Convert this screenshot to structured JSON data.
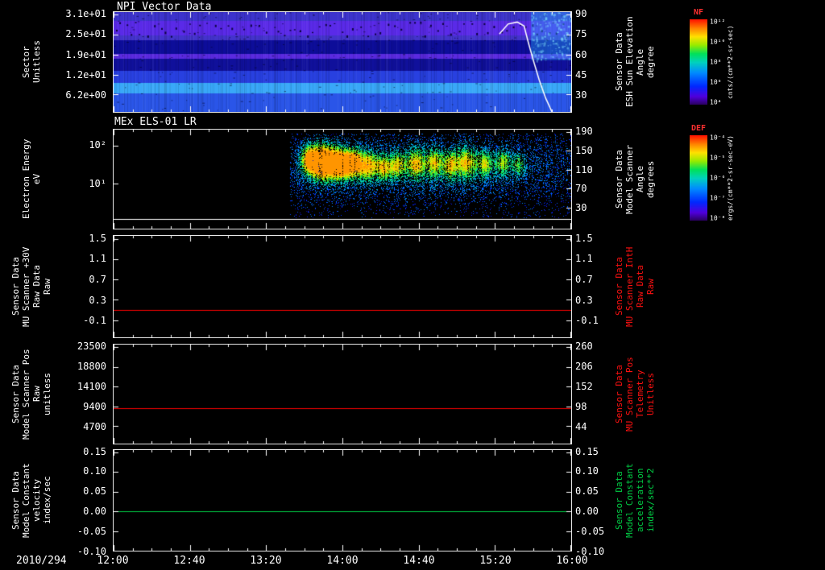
{
  "page": {
    "background": "#000000",
    "foreground": "#ffffff",
    "accent_red": "#ff1111",
    "accent_green": "#00cc44"
  },
  "titles": {
    "panel1": "NPI Vector Data",
    "panel2": "MEx ELS-01 LR"
  },
  "xaxis": {
    "date_label": "2010/294",
    "tick_labels": [
      "12:00",
      "12:40",
      "13:20",
      "14:00",
      "14:40",
      "15:20",
      "16:00"
    ]
  },
  "panels": [
    {
      "left_label_lines": [
        "Sector",
        "Unitless"
      ],
      "left_ticks": [
        "3.1e+01",
        "2.5e+01",
        "1.9e+01",
        "1.2e+01",
        "6.2e+00"
      ],
      "left_tick_fracs": [
        0.025,
        0.225,
        0.425,
        0.625,
        0.825
      ],
      "right_ticks": [
        "90",
        "75",
        "60",
        "45",
        "30"
      ],
      "right_tick_fracs": [
        0.025,
        0.225,
        0.425,
        0.625,
        0.825
      ],
      "right_label_lines": [
        "Sensor Data",
        "ESH Sun Elevation",
        "Angle",
        "degree"
      ],
      "right_label_color": "#ffffff"
    },
    {
      "left_label_lines": [
        "Electron Energy",
        "eV"
      ],
      "left_ticks": [
        "10²",
        "10¹"
      ],
      "left_tick_fracs": [
        0.16,
        0.545
      ],
      "right_ticks": [
        "190",
        "150",
        "110",
        "70",
        "30"
      ],
      "right_tick_fracs": [
        0.025,
        0.215,
        0.405,
        0.595,
        0.785
      ],
      "right_label_lines": [
        "Sensor Data",
        "Model Scanner",
        "Angle",
        "degrees"
      ],
      "right_label_color": "#ffffff"
    },
    {
      "left_label_lines": [
        "Sensor Data",
        "MU Scanner +30V",
        "Raw Data",
        "Raw"
      ],
      "left_ticks": [
        "1.5",
        "1.1",
        "0.7",
        "0.3",
        "-0.1"
      ],
      "left_tick_fracs": [
        0.03,
        0.23,
        0.43,
        0.63,
        0.83
      ],
      "right_ticks": [
        "1.5",
        "1.1",
        "0.7",
        "0.3",
        "-0.1"
      ],
      "right_tick_fracs": [
        0.03,
        0.23,
        0.43,
        0.63,
        0.83
      ],
      "right_label_lines": [
        "Sensor Data",
        "MU Scanner IntH",
        "Raw Data",
        "Raw"
      ],
      "right_label_color": "#ff1111"
    },
    {
      "left_label_lines": [
        "Sensor Data",
        "Model Scanner Pos",
        "Raw",
        "unitless"
      ],
      "left_ticks": [
        "23500",
        "18800",
        "14100",
        "9400",
        "4700"
      ],
      "left_tick_fracs": [
        0.025,
        0.225,
        0.425,
        0.625,
        0.825
      ],
      "right_ticks": [
        "260",
        "206",
        "152",
        "98",
        "44"
      ],
      "right_tick_fracs": [
        0.025,
        0.225,
        0.425,
        0.625,
        0.825
      ],
      "right_label_lines": [
        "Sensor Data",
        "MU Scanner Pos",
        "Telemetry",
        "Unitless"
      ],
      "right_label_color": "#ff1111"
    },
    {
      "left_label_lines": [
        "Sensor Data",
        "Model Constant",
        "velocity",
        "index/sec"
      ],
      "left_ticks": [
        "0.15",
        "0.10",
        "0.05",
        "0.00",
        "-0.05",
        "-0.10"
      ],
      "left_tick_fracs": [
        0.02,
        0.216,
        0.412,
        0.608,
        0.804,
        1.0
      ],
      "right_ticks": [
        "0.15",
        "0.10",
        "0.05",
        "0.00",
        "-0.05",
        "-0.10"
      ],
      "right_tick_fracs": [
        0.02,
        0.216,
        0.412,
        0.608,
        0.804,
        1.0
      ],
      "right_label_lines": [
        "Sensor Data",
        "Model Constant",
        "acceleration",
        "index/sec**2"
      ],
      "right_label_color": "#00cc44"
    }
  ],
  "colorbars": [
    {
      "title": "NF",
      "title_color": "#ff3030",
      "tick_labels": [
        "10¹²",
        "10¹⁰",
        "10⁸",
        "10⁶",
        "10⁴"
      ],
      "tick_fracs": [
        0.03,
        0.265,
        0.5,
        0.735,
        0.97
      ],
      "units": "cnts/(cm**2-sr-sec)"
    },
    {
      "title": "DEF",
      "title_color": "#ff3030",
      "tick_labels": [
        "10⁻⁴",
        "10⁻⁵",
        "10⁻⁶",
        "10⁻⁷",
        "10⁻⁸"
      ],
      "tick_fracs": [
        0.03,
        0.265,
        0.5,
        0.735,
        0.97
      ],
      "units": "ergs/(cm**2-sr-sec-eV)"
    }
  ],
  "chart_data": [
    {
      "type": "heatmap",
      "title": "NPI Vector Data",
      "x_range": [
        "12:00",
        "16:00"
      ],
      "ylabel": "Sector (Unitless)",
      "ytick_values": [
        31,
        25,
        19,
        12,
        6.2
      ],
      "y2label": "ESH Sun Elevation Angle (degree)",
      "y2tick_values": [
        90,
        75,
        60,
        45,
        30
      ],
      "colorbar_label": "NF cnts/(cm**2-sr-sec)",
      "bands": [
        {
          "y0": 0.0,
          "y1": 0.095,
          "color": "#3c33cc"
        },
        {
          "y0": 0.095,
          "y1": 0.24,
          "color": "#5a2ae8"
        },
        {
          "y0": 0.24,
          "y1": 0.29,
          "color": "#4433cc"
        },
        {
          "y0": 0.29,
          "y1": 0.42,
          "color": "#0d0d99"
        },
        {
          "y0": 0.42,
          "y1": 0.47,
          "color": "#5a2ae0"
        },
        {
          "y0": 0.47,
          "y1": 0.595,
          "color": "#10109b"
        },
        {
          "y0": 0.595,
          "y1": 0.714,
          "color": "#2840e0"
        },
        {
          "y0": 0.714,
          "y1": 0.817,
          "color": "#39a8f8"
        },
        {
          "y0": 0.817,
          "y1": 1.0,
          "color": "#2a55e8"
        }
      ],
      "bright_patch": {
        "x0": 0.912,
        "x1": 1.0,
        "y0": 0.0,
        "y1": 0.48,
        "color": "#35c8f5"
      },
      "overlay_line": {
        "name": "ESH Sun Elevation Angle trace",
        "color": "#ffffff",
        "points_frac": [
          [
            0.843,
            0.22
          ],
          [
            0.862,
            0.12
          ],
          [
            0.882,
            0.1
          ],
          [
            0.897,
            0.14
          ],
          [
            0.906,
            0.3
          ],
          [
            0.917,
            0.48
          ],
          [
            0.93,
            0.68
          ],
          [
            0.944,
            0.86
          ],
          [
            0.958,
            1.0
          ]
        ]
      }
    },
    {
      "type": "heatmap",
      "title": "MEx ELS-01 LR",
      "x_range": [
        "12:00",
        "16:00"
      ],
      "ylabel": "Electron Energy (eV)",
      "yscale": "log",
      "ytick_values": [
        100,
        10
      ],
      "y2label": "Model Scanner Angle (degrees)",
      "y2tick_values": [
        190,
        150,
        110,
        70,
        30
      ],
      "colorbar_label": "DEF ergs/(cm**2-sr-sec-eV)",
      "data_start_frac": 0.386,
      "baseline_frac": 0.9,
      "blobs": [
        {
          "x": 0.425,
          "y": 0.3,
          "rx": 0.012,
          "ry": 0.1,
          "a": 0.9
        },
        {
          "x": 0.45,
          "y": 0.32,
          "rx": 0.015,
          "ry": 0.12,
          "a": 1.0
        },
        {
          "x": 0.475,
          "y": 0.33,
          "rx": 0.02,
          "ry": 0.11,
          "a": 1.05
        },
        {
          "x": 0.5,
          "y": 0.35,
          "rx": 0.015,
          "ry": 0.1,
          "a": 0.9
        },
        {
          "x": 0.525,
          "y": 0.33,
          "rx": 0.012,
          "ry": 0.1,
          "a": 0.85
        },
        {
          "x": 0.555,
          "y": 0.36,
          "rx": 0.015,
          "ry": 0.1,
          "a": 0.8
        },
        {
          "x": 0.59,
          "y": 0.38,
          "rx": 0.012,
          "ry": 0.09,
          "a": 0.7
        },
        {
          "x": 0.62,
          "y": 0.36,
          "rx": 0.012,
          "ry": 0.09,
          "a": 0.65
        },
        {
          "x": 0.66,
          "y": 0.34,
          "rx": 0.015,
          "ry": 0.11,
          "a": 0.75
        },
        {
          "x": 0.7,
          "y": 0.33,
          "rx": 0.012,
          "ry": 0.1,
          "a": 0.7
        },
        {
          "x": 0.735,
          "y": 0.35,
          "rx": 0.012,
          "ry": 0.1,
          "a": 0.7
        },
        {
          "x": 0.77,
          "y": 0.33,
          "rx": 0.015,
          "ry": 0.11,
          "a": 0.75
        },
        {
          "x": 0.81,
          "y": 0.34,
          "rx": 0.012,
          "ry": 0.09,
          "a": 0.65
        },
        {
          "x": 0.85,
          "y": 0.33,
          "rx": 0.012,
          "ry": 0.09,
          "a": 0.6
        },
        {
          "x": 0.885,
          "y": 0.35,
          "rx": 0.01,
          "ry": 0.08,
          "a": 0.5
        },
        {
          "x": 0.65,
          "y": 0.38,
          "rx": 0.28,
          "ry": 0.22,
          "a": 0.25
        }
      ]
    },
    {
      "type": "line",
      "ylabel": "Sensor Data MU Scanner +30V Raw Data Raw",
      "y2label": "Sensor Data MU Scanner IntH Raw Data Raw",
      "ytick_values": [
        1.5,
        1.1,
        0.7,
        0.3,
        -0.1
      ],
      "series": [
        {
          "name": "MU Scanner IntH Raw Data",
          "color": "#ff0000",
          "constant_value": 0.1,
          "y_frac": 0.73
        }
      ]
    },
    {
      "type": "line",
      "ylabel": "Sensor Data Model Scanner Pos Raw unitless",
      "y2label": "Sensor Data MU Scanner Pos Telemetry Unitless",
      "ytick_values": [
        23500,
        18800,
        14100,
        9400,
        4700
      ],
      "y2tick_values": [
        260,
        206,
        152,
        98,
        44
      ],
      "series": [
        {
          "name": "MU Scanner Pos Telemetry",
          "color": "#ff0000",
          "constant_value": 8600,
          "y_frac": 0.645
        }
      ]
    },
    {
      "type": "line",
      "ylabel": "Sensor Data Model Constant velocity index/sec",
      "y2label": "Sensor Data Model Constant acceleration index/sec**2",
      "ytick_values": [
        0.15,
        0.1,
        0.05,
        0.0,
        -0.05,
        -0.1
      ],
      "series": [
        {
          "name": "Model Constant acceleration",
          "color": "#00cc44",
          "constant_value": 0.0,
          "y_frac": 0.608
        }
      ]
    }
  ]
}
